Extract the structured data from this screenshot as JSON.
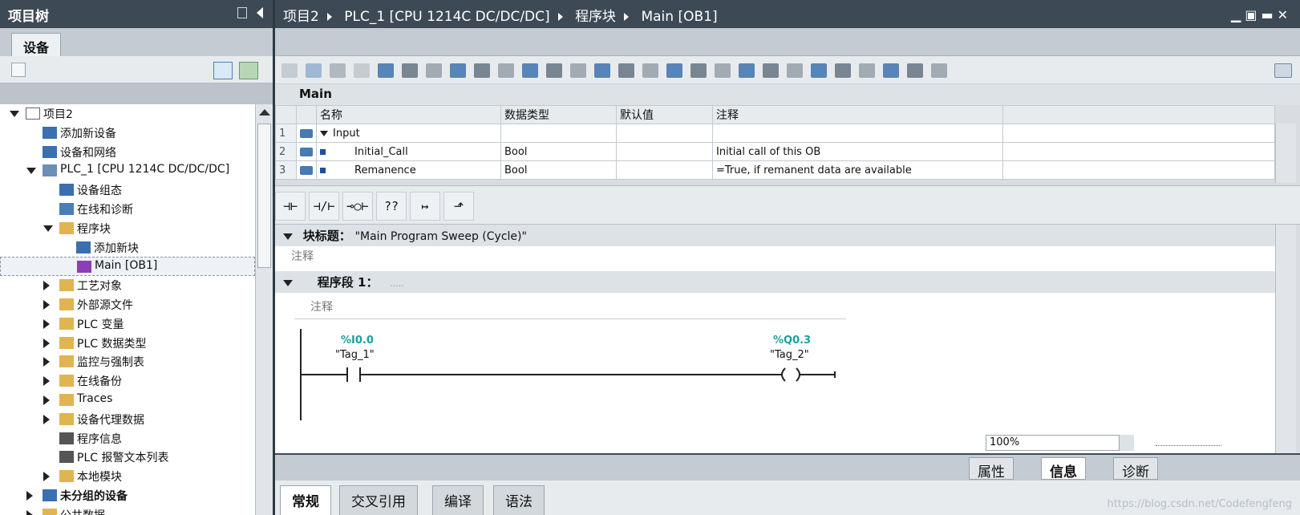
{
  "left_panel": {
    "title": "项目树",
    "tab": "设备",
    "tree": [
      {
        "label": "项目2",
        "twisty": "open",
        "indent": 0,
        "icon": "project-icon"
      },
      {
        "label": "添加新设备",
        "twisty": "",
        "indent": 1,
        "icon": "add-device-icon"
      },
      {
        "label": "设备和网络",
        "twisty": "",
        "indent": 1,
        "icon": "network-icon"
      },
      {
        "label": "PLC_1 [CPU 1214C DC/DC/DC]",
        "twisty": "open",
        "indent": 1,
        "icon": "plc-icon"
      },
      {
        "label": "设备组态",
        "twisty": "",
        "indent": 2,
        "icon": "device-config-icon"
      },
      {
        "label": "在线和诊断",
        "twisty": "",
        "indent": 2,
        "icon": "online-diag-icon"
      },
      {
        "label": "程序块",
        "twisty": "open",
        "indent": 2,
        "icon": "folder-icon"
      },
      {
        "label": "添加新块",
        "twisty": "",
        "indent": 3,
        "icon": "add-block-icon"
      },
      {
        "label": "Main [OB1]",
        "twisty": "",
        "indent": 3,
        "icon": "ob-block-icon",
        "selected": true
      },
      {
        "label": "工艺对象",
        "twisty": "closed",
        "indent": 2,
        "icon": "folder-icon"
      },
      {
        "label": "外部源文件",
        "twisty": "closed",
        "indent": 2,
        "icon": "folder-icon"
      },
      {
        "label": "PLC 变量",
        "twisty": "closed",
        "indent": 2,
        "icon": "folder-icon"
      },
      {
        "label": "PLC 数据类型",
        "twisty": "closed",
        "indent": 2,
        "icon": "folder-icon"
      },
      {
        "label": "监控与强制表",
        "twisty": "closed",
        "indent": 2,
        "icon": "folder-icon"
      },
      {
        "label": "在线备份",
        "twisty": "closed",
        "indent": 2,
        "icon": "folder-icon"
      },
      {
        "label": "Traces",
        "twisty": "closed",
        "indent": 2,
        "icon": "folder-icon"
      },
      {
        "label": "设备代理数据",
        "twisty": "closed",
        "indent": 2,
        "icon": "folder-icon"
      },
      {
        "label": "程序信息",
        "twisty": "",
        "indent": 2,
        "icon": "program-info-icon"
      },
      {
        "label": "PLC 报警文本列表",
        "twisty": "",
        "indent": 2,
        "icon": "alarm-text-icon"
      },
      {
        "label": "本地模块",
        "twisty": "closed",
        "indent": 2,
        "icon": "folder-icon"
      },
      {
        "label": "未分组的设备",
        "twisty": "closed",
        "indent": 1,
        "icon": "ungrouped-devices-icon",
        "bold": true
      },
      {
        "label": "公共数据",
        "twisty": "closed",
        "indent": 1,
        "icon": "common-data-icon"
      }
    ]
  },
  "header": {
    "breadcrumb": [
      "项目2",
      "PLC_1 [CPU 1214C DC/DC/DC]",
      "程序块",
      "Main [OB1]"
    ]
  },
  "interface": {
    "title": "Main",
    "columns": [
      "名称",
      "数据类型",
      "默认值",
      "注释"
    ],
    "rows": [
      {
        "num": "1",
        "name": "Input",
        "type": "",
        "default": "",
        "comment": "",
        "section": true
      },
      {
        "num": "2",
        "name": "Initial_Call",
        "type": "Bool",
        "default": "",
        "comment": "Initial call of this OB"
      },
      {
        "num": "3",
        "name": "Remanence",
        "type": "Bool",
        "default": "",
        "comment": "=True, if remanent data are available"
      }
    ]
  },
  "ladder_toolbar": [
    "⊣⊢",
    "⊣/⊢",
    "⊸○⊢",
    "??",
    "↦",
    "⬏"
  ],
  "block": {
    "title_label": "块标题：",
    "title_value": "\"Main Program Sweep (Cycle)\"",
    "comment": "注释"
  },
  "network": {
    "label": "程序段 1：",
    "dots": ".....",
    "comment": "注释",
    "contact": {
      "address": "%I0.0",
      "tag": "\"Tag_1\""
    },
    "coil": {
      "address": "%Q0.3",
      "tag": "\"Tag_2\""
    }
  },
  "zoom": "100%",
  "inspector_tabs": [
    "属性",
    "信息",
    "诊断"
  ],
  "bottom_tabs": [
    "常规",
    "交叉引用",
    "编译",
    "语法"
  ],
  "watermark": "https://blog.csdn.net/Codefengfeng",
  "colors": {
    "title_bar": "#3d4a55",
    "address_teal": "#1aa0a0",
    "selection": "#1d4ea0"
  }
}
